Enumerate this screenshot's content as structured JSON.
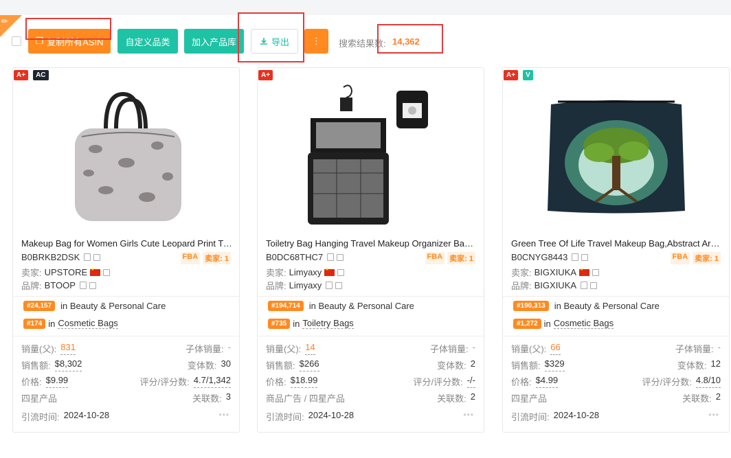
{
  "toolbar": {
    "copy_all_asin": "复制所有ASIN",
    "custom_category": "自定义品类",
    "add_to_library": "加入产品库",
    "export": "导出",
    "more_label": "⋮",
    "result_label": "搜索结果数:",
    "result_count": "14,362"
  },
  "colors": {
    "orange": "#ff8a1f",
    "teal": "#1ec2a5",
    "highlight_box": "#e23b3b"
  },
  "cards": [
    {
      "badges": [
        "A+",
        "AC"
      ],
      "title": "Makeup Bag for Women Girls Cute Leopard Print Travel Toiletry Bag",
      "asin": "B0BRKB2DSK",
      "seller_label": "卖家:",
      "seller": "UPSTORE",
      "brand_label": "品牌:",
      "brand": "BTOOP",
      "fba": "FBA",
      "sellers_tag": "卖家: 1",
      "rank_main": "#24,157",
      "rank_main_cat": "in Beauty & Personal Care",
      "rank_sub": "#174",
      "rank_sub_in": "in",
      "rank_sub_cat": "Cosmetic Bags",
      "sales_label": "销量(父):",
      "sales": "831",
      "child_sales_label": "子体销量:",
      "child_sales": "-",
      "revenue_label": "销售额:",
      "revenue": "$8,302",
      "variants_label": "变体数:",
      "variants": "30",
      "price_label": "价格:",
      "price": "$9.99",
      "rating_label": "评分/评分数:",
      "rating": "4.7/1,342",
      "type": "四星产品",
      "related_label": "关联数:",
      "related": "3",
      "traffic_label": "引流时间:",
      "traffic_date": "2024-10-28"
    },
    {
      "badges": [
        "A+"
      ],
      "title": "Toiletry Bag Hanging Travel Makeup Organizer Bag for Women",
      "asin": "B0DC68THC7",
      "seller_label": "卖家:",
      "seller": "Limyaxy",
      "brand_label": "品牌:",
      "brand": "Limyaxy",
      "fba": "FBA",
      "sellers_tag": "卖家: 1",
      "rank_main": "#194,714",
      "rank_main_cat": "in Beauty & Personal Care",
      "rank_sub": "#735",
      "rank_sub_in": "in",
      "rank_sub_cat": "Toiletry Bags",
      "sales_label": "销量(父):",
      "sales": "14",
      "child_sales_label": "子体销量:",
      "child_sales": "-",
      "revenue_label": "销售额:",
      "revenue": "$266",
      "variants_label": "变体数:",
      "variants": "2",
      "price_label": "价格:",
      "price": "$18.99",
      "rating_label": "评分/评分数:",
      "rating": "-/-",
      "type": "商品广告 / 四星产品",
      "related_label": "关联数:",
      "related": "2",
      "traffic_label": "引流时间:",
      "traffic_date": "2024-10-28"
    },
    {
      "badges": [
        "A+",
        "V"
      ],
      "title": "Green Tree Of Life Travel Makeup Bag,Abstract Art Cosmetic Bag",
      "asin": "B0CNYG8443",
      "seller_label": "卖家:",
      "seller": "BIGXIUKA",
      "brand_label": "品牌:",
      "brand": "BIGXIUKA",
      "fba": "FBA",
      "sellers_tag": "卖家: 1",
      "rank_main": "#190,313",
      "rank_main_cat": "in Beauty & Personal Care",
      "rank_sub": "#1,272",
      "rank_sub_in": "in",
      "rank_sub_cat": "Cosmetic Bags",
      "sales_label": "销量(父):",
      "sales": "66",
      "child_sales_label": "子体销量:",
      "child_sales": "-",
      "revenue_label": "销售额:",
      "revenue": "$329",
      "variants_label": "变体数:",
      "variants": "12",
      "price_label": "价格:",
      "price": "$4.99",
      "rating_label": "评分/评分数:",
      "rating": "4.8/10",
      "type": "四星产品",
      "related_label": "关联数:",
      "related": "2",
      "traffic_label": "引流时间:",
      "traffic_date": "2024-10-28"
    }
  ]
}
